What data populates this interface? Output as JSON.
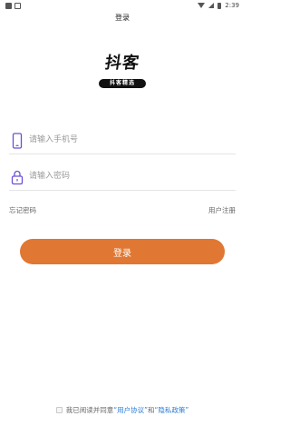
{
  "statusbar": {
    "time": "2:39"
  },
  "header": {
    "title": "登录"
  },
  "logo": {
    "main_text": "抖客",
    "pill_text": "抖客精选"
  },
  "form": {
    "phone_placeholder": "请输入手机号",
    "password_placeholder": "请输入密码"
  },
  "links": {
    "forgot_password": "忘记密码",
    "register": "用户注册"
  },
  "login_button_label": "登录",
  "agreement": {
    "prefix": "我已阅读并同意",
    "user_agreement": "“用户协议”",
    "and": "和",
    "privacy_policy": "“隐私政策”"
  },
  "colors": {
    "accent": "#e07732",
    "link": "#2a7dd8",
    "icon_purple": "#6b4fd8"
  }
}
